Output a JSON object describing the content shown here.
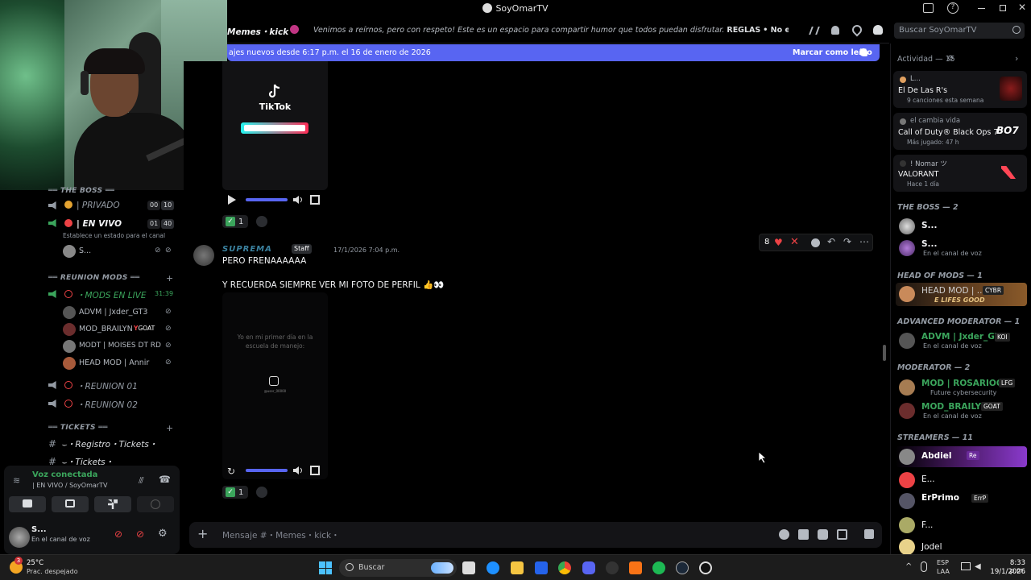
{
  "window": {
    "title": "SoyOmarTV"
  },
  "channel": {
    "name": "Memes・kick・",
    "topic": "Venimos a reírnos, pero con respeto! Este es un espacio para compartir humor que todos puedan disfrutar.",
    "topic_rules": "REGLAS",
    "topic_rule1": "No envíes memes que conten...",
    "search_placeholder": "Buscar SoyOmarTV"
  },
  "new_messages_bar": {
    "text": "ajes nuevos desde 6:17 p.m. el 16 de enero de 2026",
    "action": "Marcar como leído"
  },
  "sidebar": {
    "categories": [
      {
        "label": "THE BOSS",
        "channels": [
          {
            "name": "| PRIVADO",
            "count_left": "00",
            "count_right": "10"
          },
          {
            "name": "| EN VIVO",
            "count_left": "01",
            "count_right": "40",
            "status": "Establece un estado para el canal",
            "user": "S..."
          }
        ]
      },
      {
        "label": "REUNION MODS",
        "channels": [
          {
            "name": "MODS EN LIVE",
            "timer": "31:39"
          },
          {
            "name": "REUNION 01"
          },
          {
            "name": "REUNION 02"
          }
        ]
      },
      {
        "label": "TICKETS",
        "channels": [
          {
            "name": "・Registro・Tickets・"
          },
          {
            "name": "・Tickets・"
          }
        ]
      }
    ],
    "voice_users": [
      "ADVM | Jxder_GT3",
      "MOD_BRAILYN",
      "MODT | MOISES DT RD",
      "HEAD MOD | Annir"
    ],
    "voice_badge_goat": "GOAT",
    "voice_status": {
      "title": "Voz conectada",
      "subtitle": "| EN VIVO / SoyOmarTV"
    },
    "user_panel": {
      "name": "S...",
      "status": "En el canal de voz"
    }
  },
  "messages": [
    {
      "media": "tiktok",
      "tiktok_label": "TikTok",
      "reaction_count": "1"
    },
    {
      "author": "SUPREMA",
      "role_badge": "Staff",
      "timestamp": "17/1/2026 7:04 p.m.",
      "lines": [
        "PERO FRENAAAAAA",
        "Y RECUERDA SIEMPRE VER MI FOTO DE PERFIL"
      ],
      "video_caption": "Yo en mi primer día en la escuela de manejo:",
      "video_handle": "@user_00000",
      "reaction_count": "1",
      "hover_reaction_count": "8"
    }
  ],
  "composer": {
    "placeholder": "Mensaje #・Memes・kick・"
  },
  "members": {
    "activity_header": "Actividad — 15",
    "activities": [
      {
        "user": "L...",
        "title": "El De Las R's",
        "detail": "9 canciones esta semana"
      },
      {
        "user": "el cambia vida",
        "title": "Call of Duty® Black Ops 7",
        "detail": "Más jugado: 47 h",
        "logo": "BO7"
      },
      {
        "user": "! Nomar ツ",
        "title": "VALORANT",
        "detail": "Hace 1 día"
      }
    ],
    "groups": [
      {
        "label": "THE BOSS",
        "count": "2",
        "members": [
          {
            "name": "S...",
            "sub": ""
          },
          {
            "name": "S...",
            "sub": "En el canal de voz"
          }
        ]
      },
      {
        "label": "HEAD OF MODS",
        "count": "1",
        "members": [
          {
            "name": "HEAD MOD | ...",
            "sub": "E LIFES GOOD",
            "tag": "CYBR"
          }
        ]
      },
      {
        "label": "ADVANCED MODERATOR",
        "count": "1",
        "members": [
          {
            "name": "ADVM | Jxder_GT3",
            "sub": "En el canal de voz",
            "tag": "KOI"
          }
        ]
      },
      {
        "label": "MODERATOR",
        "count": "2",
        "members": [
          {
            "name": "MOD | ROSARIOO...",
            "sub": "Future cybersecurity",
            "tag": "LFG"
          },
          {
            "name": "MOD_BRAILYN",
            "sub": "En el canal de voz",
            "tag": "GOAT"
          }
        ]
      },
      {
        "label": "STREAMERS",
        "count": "11",
        "members": [
          {
            "name": "Abdiel",
            "tag": "Re"
          },
          {
            "name": "E..."
          },
          {
            "name": "ErPrimo",
            "tag": "ErrP"
          },
          {
            "name": "F..."
          },
          {
            "name": "Jodel"
          }
        ]
      }
    ]
  },
  "taskbar": {
    "weather_temp": "25°C",
    "weather_desc": "Prac. despejado",
    "search": "Buscar",
    "lang1": "ESP",
    "lang2": "LAA",
    "time": "8:33 p.m.",
    "date": "19/1/2026",
    "notif_count": "3"
  }
}
